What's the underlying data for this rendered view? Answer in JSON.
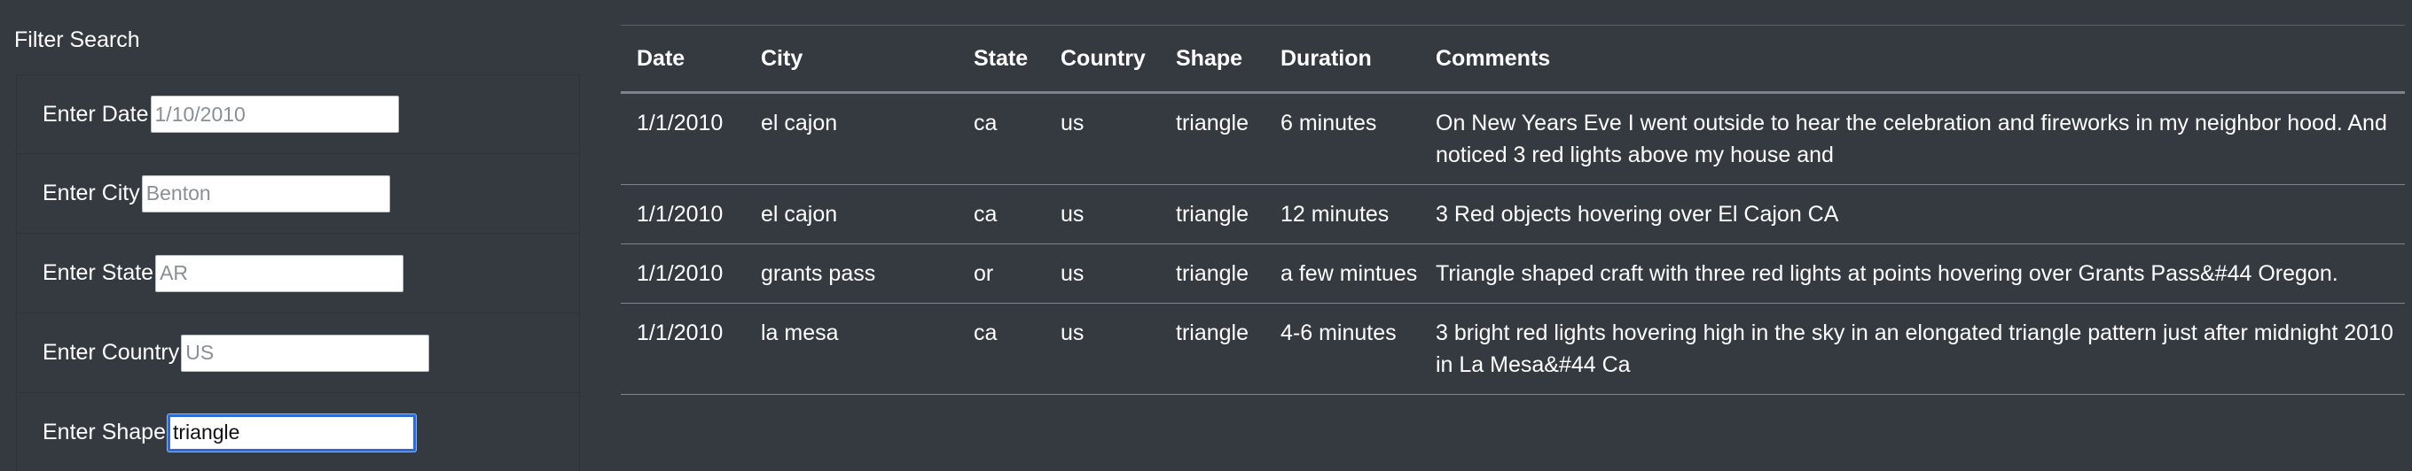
{
  "sidebar": {
    "title": "Filter Search",
    "filters": [
      {
        "label": "Enter Date",
        "placeholder": "1/10/2010",
        "value": ""
      },
      {
        "label": "Enter City",
        "placeholder": "Benton",
        "value": ""
      },
      {
        "label": "Enter State",
        "placeholder": "AR",
        "value": ""
      },
      {
        "label": "Enter Country",
        "placeholder": "US",
        "value": ""
      },
      {
        "label": "Enter Shape",
        "placeholder": "",
        "value": "triangle"
      }
    ]
  },
  "table": {
    "headers": {
      "date": "Date",
      "city": "City",
      "state": "State",
      "country": "Country",
      "shape": "Shape",
      "duration": "Duration",
      "comments": "Comments"
    },
    "rows": [
      {
        "date": "1/1/2010",
        "city": "el cajon",
        "state": "ca",
        "country": "us",
        "shape": "triangle",
        "duration": "6 minutes",
        "comments": "On New Years Eve I went outside to hear the celebration and fireworks in my neighbor hood. And noticed 3 red lights above my house and"
      },
      {
        "date": "1/1/2010",
        "city": "el cajon",
        "state": "ca",
        "country": "us",
        "shape": "triangle",
        "duration": "12 minutes",
        "comments": "3 Red objects hovering over El Cajon CA"
      },
      {
        "date": "1/1/2010",
        "city": "grants pass",
        "state": "or",
        "country": "us",
        "shape": "triangle",
        "duration": "a few mintues",
        "comments": "Triangle shaped craft with three red lights at points hovering over Grants Pass&#44 Oregon."
      },
      {
        "date": "1/1/2010",
        "city": "la mesa",
        "state": "ca",
        "country": "us",
        "shape": "triangle",
        "duration": "4-6 minutes",
        "comments": "3 bright red lights hovering high in the sky in an elongated triangle pattern just after midnight 2010 in La Mesa&#44 Ca"
      }
    ]
  },
  "colors": {
    "background": "#353a40",
    "row_border": "#7d848b",
    "input_focus": "#2b6cd8"
  }
}
